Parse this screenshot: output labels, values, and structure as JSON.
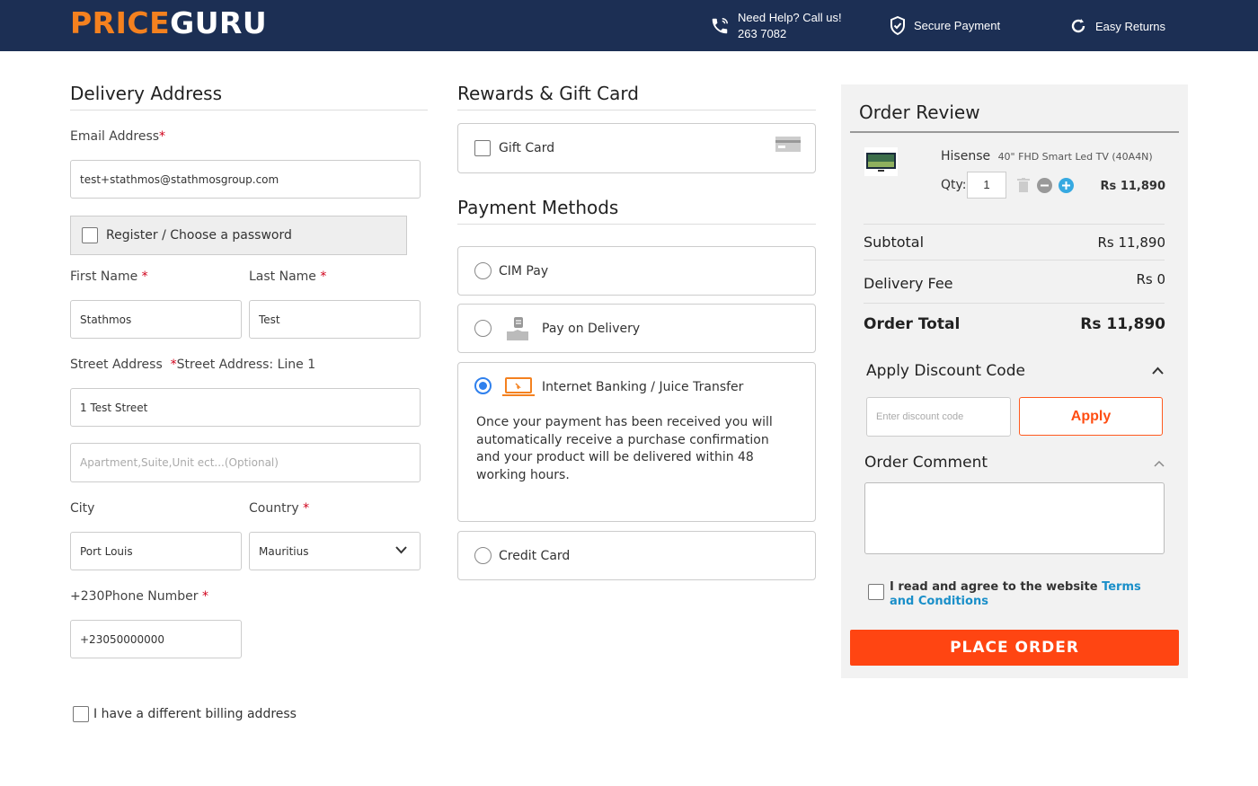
{
  "header": {
    "logo_part1": "PRICE",
    "logo_part2": "GURU",
    "help_line1": "Need Help? Call us!",
    "help_line2": "263 7082",
    "secure": "Secure Payment",
    "returns": "Easy Returns"
  },
  "delivery": {
    "title": "Delivery Address",
    "email_label": "Email Address",
    "email_value": "test+stathmos@stathmosgroup.com",
    "register_label": "Register / Choose a password",
    "first_name_label": "First Name",
    "first_name_value": "Stathmos",
    "last_name_label": "Last Name",
    "last_name_value": "Test",
    "street_label": "Street Address",
    "street_line_label": "Street Address: Line 1",
    "street_value": "1 Test Street",
    "street2_placeholder": "Apartment,Suite,Unit ect...(Optional)",
    "city_label": "City",
    "city_value": "Port Louis",
    "country_label": "Country",
    "country_value": "Mauritius",
    "phone_label": "+230Phone Number",
    "phone_value": "+23050000000",
    "billing_label": "I have a different billing address"
  },
  "rewards": {
    "title": "Rewards & Gift Card",
    "gift_card_label": "Gift Card"
  },
  "payment": {
    "title": "Payment Methods",
    "options": [
      {
        "label": "CIM Pay",
        "selected": false
      },
      {
        "label": "Pay on Delivery",
        "selected": false
      },
      {
        "label": "Internet Banking / Juice Transfer",
        "selected": true
      },
      {
        "label": "Credit Card",
        "selected": false
      }
    ],
    "banking_note": "Once your payment has been received you will automatically receive a purchase confirmation and your product will be delivered within 48 working hours."
  },
  "review": {
    "title": "Order Review",
    "item_brand": "Hisense",
    "item_name": "40\" FHD Smart Led TV (40A4N)",
    "qty_label": "Qty:",
    "qty_value": "1",
    "item_price": "Rs 11,890",
    "subtotal_label": "Subtotal",
    "subtotal_value": "Rs 11,890",
    "delivery_label": "Delivery Fee",
    "delivery_value": "Rs 0",
    "total_label": "Order Total",
    "total_value": "Rs 11,890",
    "discount_title": "Apply Discount Code",
    "discount_placeholder": "Enter discount code",
    "apply_label": "Apply",
    "comment_title": "Order Comment",
    "terms_text": "I read and agree to the website ",
    "terms_link": "Terms and Conditions",
    "place_order": "PLACE ORDER"
  },
  "colors": {
    "header_bg": "#1c2f54",
    "logo_orange": "#f4811f",
    "accent": "#ff4512",
    "link": "#1a8fc9",
    "radio_selected": "#2f80ed"
  }
}
